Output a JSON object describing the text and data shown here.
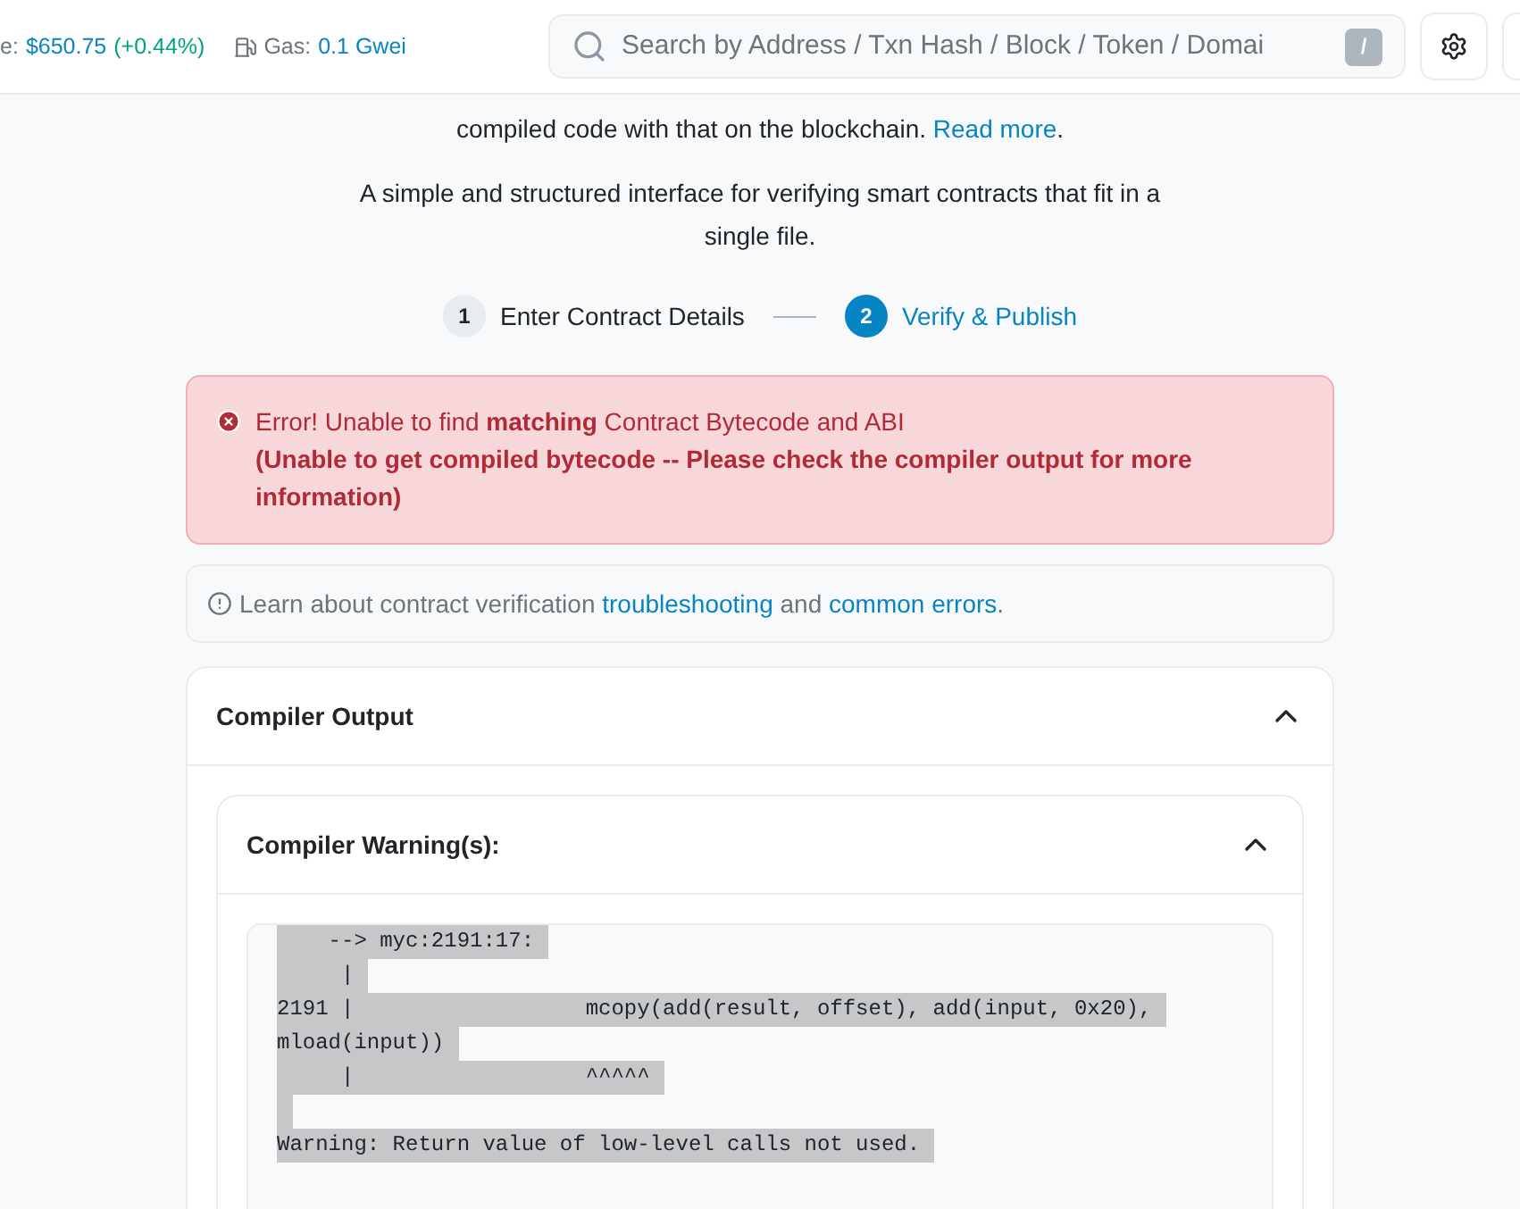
{
  "header": {
    "price_label": "e:",
    "price": "$650.75",
    "change": "(+0.44%)",
    "gas_label": "Gas:",
    "gas_value": "0.1 Gwei",
    "search": {
      "placeholder": "Search by Address / Txn Hash / Block / Token / Domai",
      "shortcut": "/"
    }
  },
  "intro": {
    "line": "compiled code with that on the blockchain.",
    "link": "Read more",
    "after": ".",
    "description": "A simple and structured interface for verifying smart contracts that fit in a single file."
  },
  "steps": [
    {
      "number": "1",
      "label": "Enter Contract Details",
      "selected": false
    },
    {
      "number": "2",
      "label": "Verify & Publish",
      "selected": true
    }
  ],
  "error": {
    "title": "Error! Unable to find **matching** Contract Bytecode and ABI",
    "detail": "(Unable to get compiled bytecode -- Please check the compiler output for more information)"
  },
  "info": {
    "text": "Learn about contract verification",
    "link1": "troubleshooting",
    "middle": "and",
    "link2": "common errors",
    "end": "."
  },
  "compiler_output": {
    "title": "Compiler Output",
    "expanded": true,
    "warnings": {
      "title": "Compiler Warning(s):",
      "expanded": true,
      "lines": [
        {
          "kind": "text",
          "text": "    --> myc:2191:17:"
        },
        {
          "kind": "text",
          "text": "     |"
        },
        {
          "kind": "text",
          "text": "2191 |                  mcopy(add(result, offset), add(input, 0x20),"
        },
        {
          "kind": "text",
          "text": "mload(input))"
        },
        {
          "kind": "text",
          "text": "     |                  ^^^^^"
        },
        {
          "kind": "blank"
        },
        {
          "kind": "text",
          "text": "Warning: Return value of low-level calls not used."
        }
      ]
    }
  }
}
